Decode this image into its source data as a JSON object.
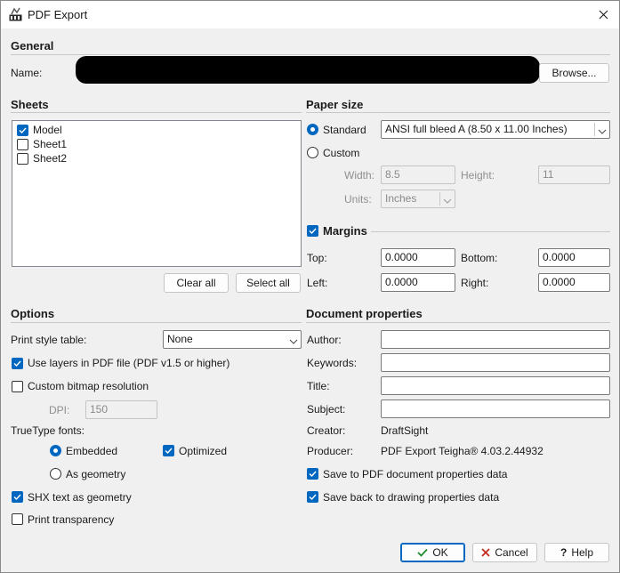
{
  "window": {
    "title": "PDF Export"
  },
  "general": {
    "heading": "General",
    "name_label": "Name:",
    "name_value": "",
    "browse_label": "Browse..."
  },
  "sheets": {
    "heading": "Sheets",
    "items": [
      {
        "label": "Model",
        "checked": true
      },
      {
        "label": "Sheet1",
        "checked": false
      },
      {
        "label": "Sheet2",
        "checked": false
      }
    ],
    "clear_all_label": "Clear all",
    "select_all_label": "Select all"
  },
  "paper_size": {
    "heading": "Paper size",
    "standard_label": "Standard",
    "standard_value": "ANSI full bleed A (8.50 x 11.00 Inches)",
    "custom_label": "Custom",
    "width_label": "Width:",
    "width_value": "8.5",
    "height_label": "Height:",
    "height_value": "11",
    "units_label": "Units:",
    "units_value": "Inches"
  },
  "margins": {
    "heading": "Margins",
    "top_label": "Top:",
    "top_value": "0.0000",
    "bottom_label": "Bottom:",
    "bottom_value": "0.0000",
    "left_label": "Left:",
    "left_value": "0.0000",
    "right_label": "Right:",
    "right_value": "0.0000"
  },
  "options": {
    "heading": "Options",
    "print_style_label": "Print style table:",
    "print_style_value": "None",
    "use_layers_label": "Use layers in PDF file (PDF v1.5 or higher)",
    "custom_bitmap_label": "Custom bitmap resolution",
    "dpi_label": "DPI:",
    "dpi_value": "150",
    "truetype_label": "TrueType fonts:",
    "embedded_label": "Embedded",
    "optimized_label": "Optimized",
    "as_geometry_label": "As geometry",
    "shx_label": "SHX text as geometry",
    "print_transparency_label": "Print transparency"
  },
  "doc_props": {
    "heading": "Document properties",
    "author_label": "Author:",
    "author_value": "",
    "keywords_label": "Keywords:",
    "keywords_value": "",
    "title_label": "Title:",
    "title_value": "",
    "subject_label": "Subject:",
    "subject_value": "",
    "creator_label": "Creator:",
    "creator_value": "DraftSight",
    "producer_label": "Producer:",
    "producer_value": "PDF Export Teigha® 4.03.2.44932",
    "save_to_pdf_label": "Save to PDF document properties data",
    "save_back_label": "Save back to drawing properties data"
  },
  "footer": {
    "ok_label": "OK",
    "cancel_label": "Cancel",
    "help_label": "Help"
  },
  "colors": {
    "accent": "#0067c0",
    "ok_check": "#1f8b2c",
    "cancel_x": "#c42b1c"
  }
}
